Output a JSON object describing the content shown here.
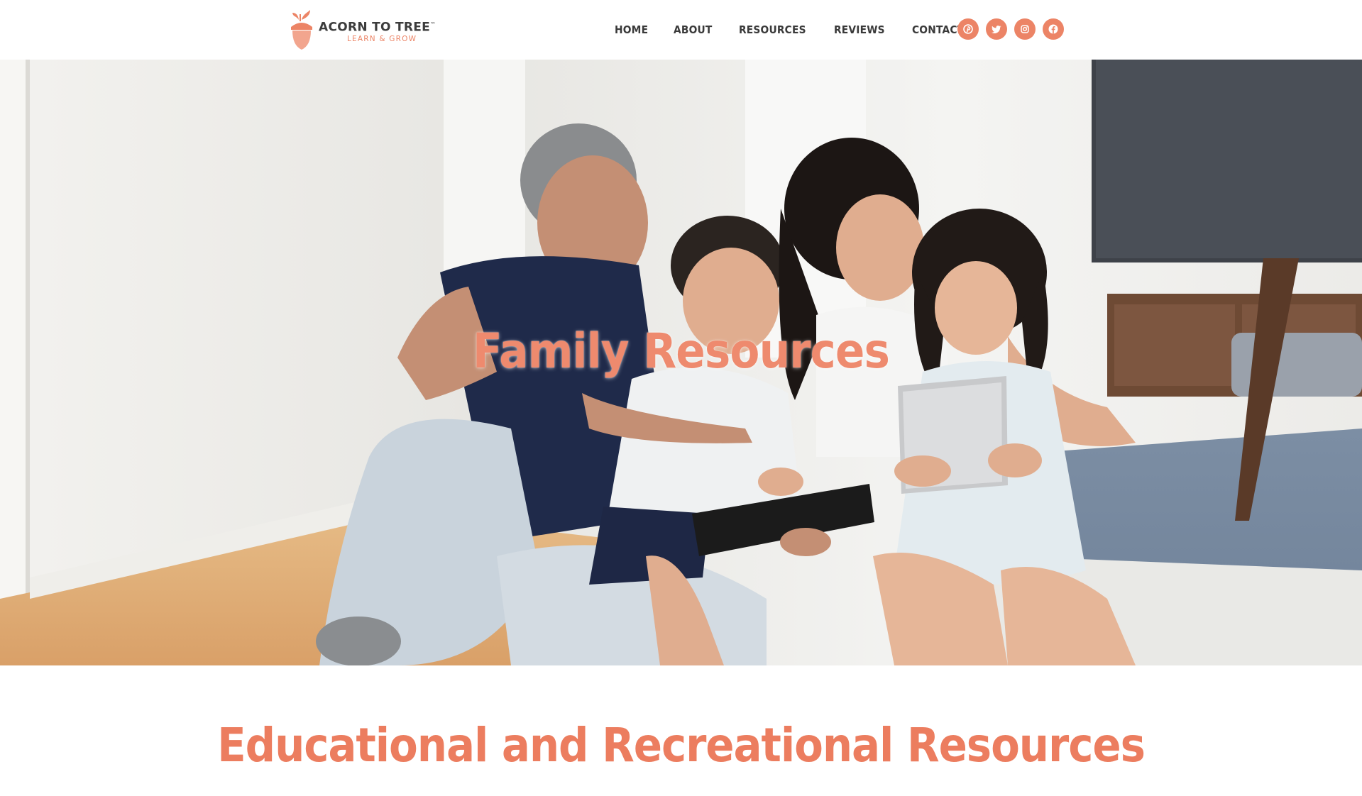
{
  "brand": {
    "name": "ACORN TO TREE",
    "trademark": "™",
    "tagline": "LEARN & GROW",
    "accent_color": "#ec8466"
  },
  "nav": {
    "items": [
      {
        "label": "HOME"
      },
      {
        "label": "ABOUT"
      },
      {
        "label": "RESOURCES"
      },
      {
        "label": "REVIEWS"
      },
      {
        "label": "CONTACT"
      }
    ]
  },
  "socials": [
    {
      "icon": "pinterest-icon"
    },
    {
      "icon": "twitter-icon"
    },
    {
      "icon": "instagram-icon"
    },
    {
      "icon": "facebook-icon"
    }
  ],
  "hero": {
    "title": "Family Resources"
  },
  "section": {
    "title": "Educational and Recreational Resources"
  }
}
